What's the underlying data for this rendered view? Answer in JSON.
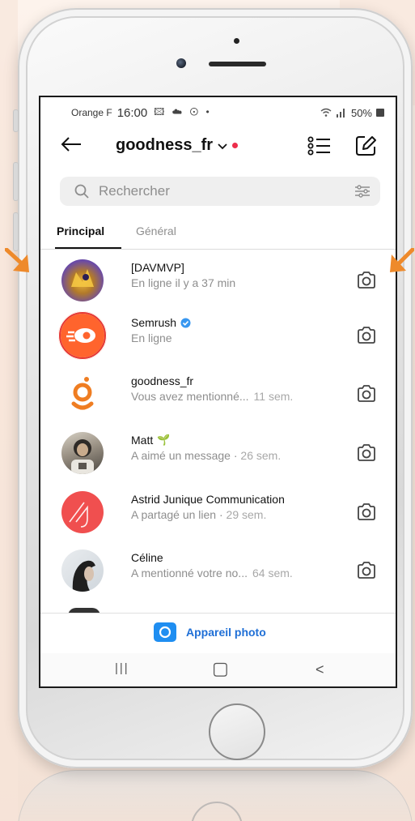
{
  "status_bar": {
    "carrier": "Orange F",
    "time": "16:00",
    "notification_icons": "🖾 ☁ ⊙ •",
    "battery": "50%"
  },
  "header": {
    "account_name": "goodness_fr",
    "back_icon": "arrow-left-icon",
    "list_icon": "list-icon",
    "edit_icon": "new-message-icon"
  },
  "search": {
    "placeholder": "Rechercher"
  },
  "tabs": [
    {
      "label": "Principal",
      "active": true
    },
    {
      "label": "Général",
      "active": false
    }
  ],
  "conversations": [
    {
      "name": "[DAVMVP]",
      "subtitle": "En ligne il y a 37 min",
      "time": ""
    },
    {
      "name": "Semrush",
      "subtitle": "En ligne",
      "time": "",
      "verified": true
    },
    {
      "name": "goodness_fr",
      "subtitle": "Vous avez mentionné...",
      "time": "11 sem."
    },
    {
      "name": "Matt",
      "subtitle": "A aimé un message ·",
      "time": "26 sem.",
      "badge": "🌱"
    },
    {
      "name": "Astrid Junique Communication",
      "subtitle": "A partagé un lien ·",
      "time": "29 sem."
    },
    {
      "name": "Céline",
      "subtitle": "A mentionné votre no...",
      "time": "64 sem."
    }
  ],
  "bottom": {
    "camera_label": "Appareil photo"
  },
  "nav": {
    "recents": "|||",
    "home": "▢",
    "back": "<"
  },
  "colors": {
    "accent_blue": "#1f8ef1",
    "unread_dot": "#ed2d4b",
    "callout_arrow": "#ee8a2b",
    "semrush": "#ff642d",
    "astrid": "#f04f4f",
    "goodness_orange": "#ef7d22"
  }
}
